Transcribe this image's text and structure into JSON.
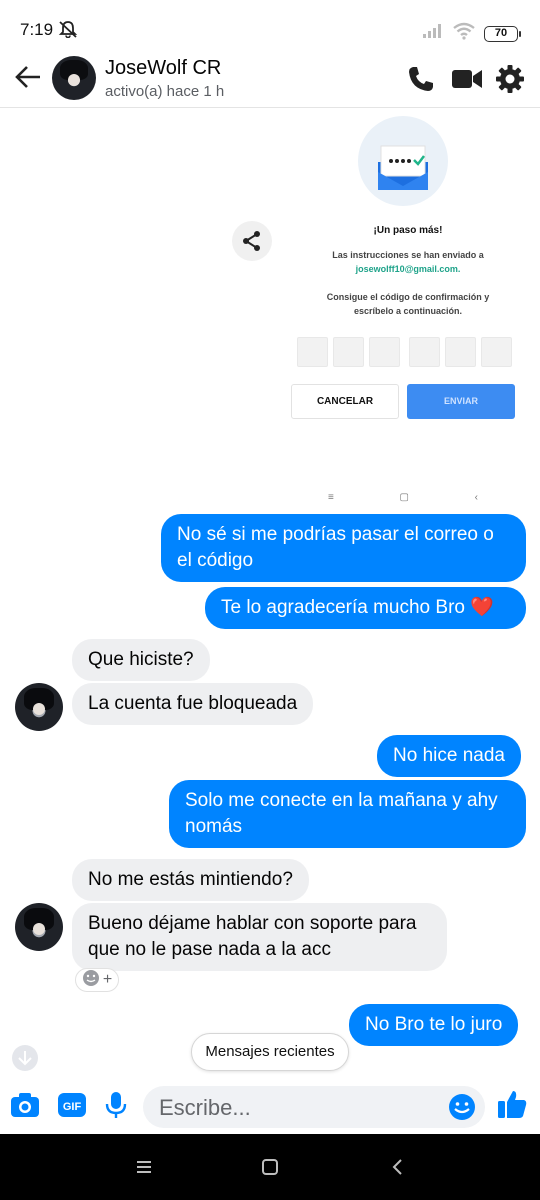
{
  "status_bar": {
    "time": "7:19",
    "battery": "70"
  },
  "header": {
    "name": "JoseWolf CR",
    "status": "activo(a) hace 1 h"
  },
  "shared_image": {
    "title": "¡Un paso más!",
    "line1": "Las instrucciones se han enviado a",
    "email": "josewolff10@gmail.com.",
    "line2": "Consigue el código de confirmación y",
    "line3": "escríbelo a continuación.",
    "cancel": "CANCELAR",
    "send": "ENVIAR",
    "nav": [
      "≡",
      "▢",
      "‹"
    ]
  },
  "messages": [
    {
      "text1": "No sé si me podrías pasar el correo o",
      "text2": "el código"
    },
    {
      "text": "Te lo agradecería mucho Bro ❤️"
    },
    {
      "text": "Que hiciste?"
    },
    {
      "text": "La cuenta fue bloqueada"
    },
    {
      "text": "No hice nada"
    },
    {
      "text1": "Solo me conecte en la mañana y ahy",
      "text2": "nomás"
    },
    {
      "text": "No me estás mintiendo?"
    },
    {
      "text1": "Bueno déjame hablar con soporte para",
      "text2": "que no le pase nada a la acc"
    },
    {
      "text": "No Bro te lo juro"
    }
  ],
  "reaction_add": "+",
  "recent_button": "Mensajes recientes",
  "composer": {
    "placeholder": "Escribe..."
  },
  "colors": {
    "accent": "#0084ff",
    "incoming": "#eeeff1"
  },
  "icons": [
    "back-arrow-icon",
    "phone-icon",
    "video-icon",
    "gear-icon",
    "share-icon",
    "camera-icon",
    "gif-icon",
    "mic-icon",
    "emoji-icon",
    "like-icon"
  ]
}
